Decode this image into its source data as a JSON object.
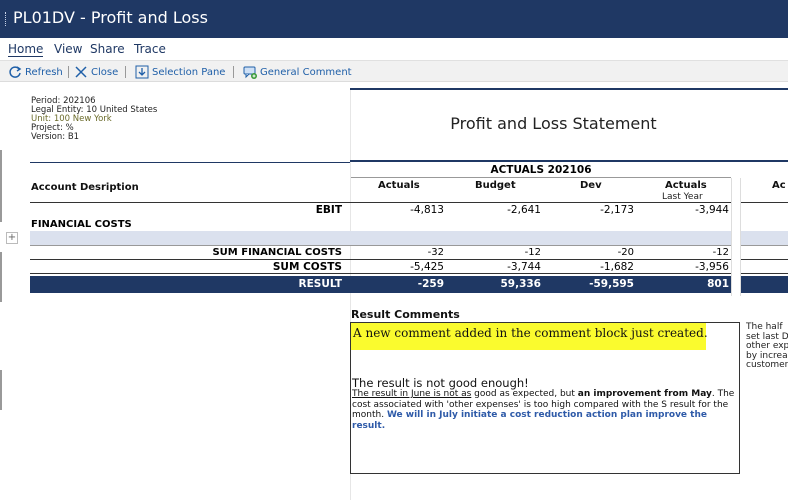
{
  "window": {
    "title": "PL01DV - Profit and Loss"
  },
  "menu": {
    "home": "Home",
    "view": "View",
    "share": "Share",
    "trace": "Trace"
  },
  "toolbar": {
    "refresh": "Refresh",
    "close": "Close",
    "selection_pane": "Selection Pane",
    "general_comment": "General Comment"
  },
  "context": {
    "period": "Period: 202106",
    "legal_entity": "Legal Entity: 10 United States",
    "unit": "Unit: 100 New York",
    "project": "Project: %",
    "version": "Version: B1"
  },
  "report": {
    "title": "Profit and Loss Statement"
  },
  "table": {
    "row_header": "Account  Desription",
    "group_header": "ACTUALS 202106",
    "columns": [
      "Actuals",
      "Budget",
      "Dev",
      "Actuals",
      "Ac"
    ],
    "last_year_label": "Last Year",
    "rows": [
      {
        "label": "EBIT",
        "values": [
          "-4,813",
          "-2,641",
          "-2,173",
          "-3,944"
        ]
      },
      {
        "label": "FINANCIAL COSTS",
        "values": []
      },
      {
        "label": "SUM FINANCIAL COSTS",
        "values": [
          "-32",
          "-12",
          "-20",
          "-12"
        ]
      },
      {
        "label": "SUM COSTS",
        "values": [
          "-5,425",
          "-3,744",
          "-1,682",
          "-3,956"
        ]
      },
      {
        "label": "RESULT",
        "values": [
          "-259",
          "59,336",
          "-59,595",
          "801"
        ]
      }
    ]
  },
  "comments": {
    "title": "Result Comments",
    "highlighted": "A new comment added in the comment block just created.",
    "headline": "The result is not good enough!",
    "body_underlined": "The result in June is not as",
    "body_1": " good as expected, but ",
    "body_bold": "an improvement from May",
    "body_2": ". The cost associated with 'other expenses' is too high compared with the S result for the month. ",
    "body_blue": "We will in July initiate a cost reduction action plan improve the result.",
    "side_note": "The half\nset last D\nother exp\nby increa\ncustomer"
  },
  "colors": {
    "title_bar": "#1f3864",
    "highlight": "#fafb2e",
    "result_row": "#1f3864",
    "band": "#dbe1ee"
  }
}
